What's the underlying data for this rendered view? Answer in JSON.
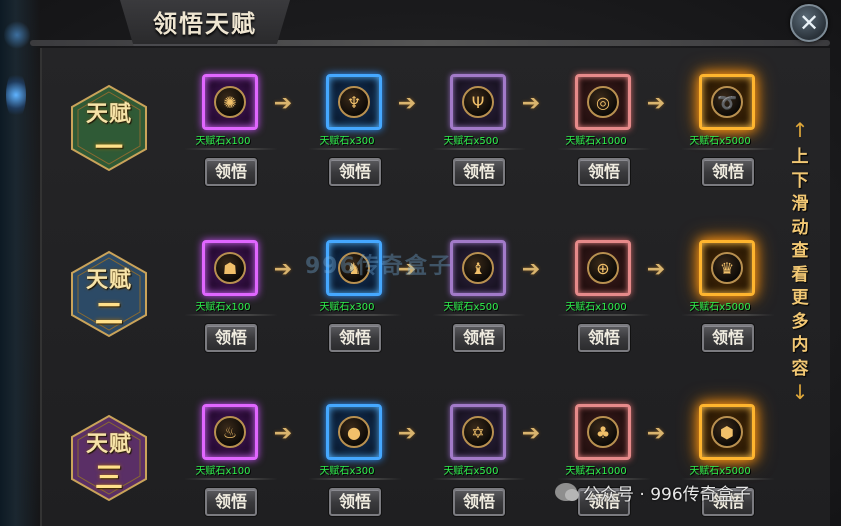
{
  "window": {
    "title": "领悟天赋",
    "close_glyph": "✕"
  },
  "rows": [
    {
      "badge_top": "天赋",
      "badge_num": "一",
      "badge_color": "#2f5a36",
      "nodes": [
        {
          "frame": "purple",
          "icon": "seal-icon",
          "cost": "天赋石x100",
          "button": "领悟"
        },
        {
          "frame": "blue",
          "icon": "phoenix-icon",
          "cost": "天赋石x300",
          "button": "领悟"
        },
        {
          "frame": "violet",
          "icon": "trident-icon",
          "cost": "天赋石x500",
          "button": "领悟"
        },
        {
          "frame": "red",
          "icon": "swirl-icon",
          "cost": "天赋石x1000",
          "button": "领悟"
        },
        {
          "frame": "gold",
          "icon": "spiral-icon",
          "cost": "天赋石x5000",
          "button": "领悟"
        }
      ]
    },
    {
      "badge_top": "天赋",
      "badge_num": "二",
      "badge_color": "#2c4a66",
      "nodes": [
        {
          "frame": "purple",
          "icon": "demon-mask-icon",
          "cost": "天赋石x100",
          "button": "领悟"
        },
        {
          "frame": "blue",
          "icon": "beast-icon",
          "cost": "天赋石x300",
          "button": "领悟"
        },
        {
          "frame": "violet",
          "icon": "dragon-icon",
          "cost": "天赋石x500",
          "button": "领悟"
        },
        {
          "frame": "red",
          "icon": "target-icon",
          "cost": "天赋石x1000",
          "button": "领悟"
        },
        {
          "frame": "gold",
          "icon": "crown-icon",
          "cost": "天赋石x5000",
          "button": "领悟"
        }
      ]
    },
    {
      "badge_top": "天赋",
      "badge_num": "三",
      "badge_color": "#5a2f66",
      "nodes": [
        {
          "frame": "purple",
          "icon": "flame-icon",
          "cost": "天赋石x100",
          "button": "领悟"
        },
        {
          "frame": "blue",
          "icon": "orb-icon",
          "cost": "天赋石x300",
          "button": "领悟"
        },
        {
          "frame": "violet",
          "icon": "hexagram-icon",
          "cost": "天赋石x500",
          "button": "领悟"
        },
        {
          "frame": "red",
          "icon": "bird-icon",
          "cost": "天赋石x1000",
          "button": "领悟"
        },
        {
          "frame": "gold",
          "icon": "shield-icon",
          "cost": "天赋石x5000",
          "button": "领悟"
        }
      ]
    }
  ],
  "icon_glyphs": {
    "seal-icon": "✺",
    "phoenix-icon": "♆",
    "trident-icon": "Ψ",
    "swirl-icon": "◎",
    "spiral-icon": "➰",
    "demon-mask-icon": "☗",
    "beast-icon": "♞",
    "dragon-icon": "♝",
    "target-icon": "⊕",
    "crown-icon": "♛",
    "flame-icon": "♨",
    "orb-icon": "●",
    "hexagram-icon": "✡",
    "bird-icon": "♣",
    "shield-icon": "⬢"
  },
  "side_hint": {
    "text": "上下滑动查看更多内容",
    "up_glyph": "↑",
    "down_glyph": "↓"
  },
  "watermark": {
    "center": "996传奇盒子",
    "footer": "公众号 · 996传奇盒子"
  },
  "arrow_glyph": "➔"
}
